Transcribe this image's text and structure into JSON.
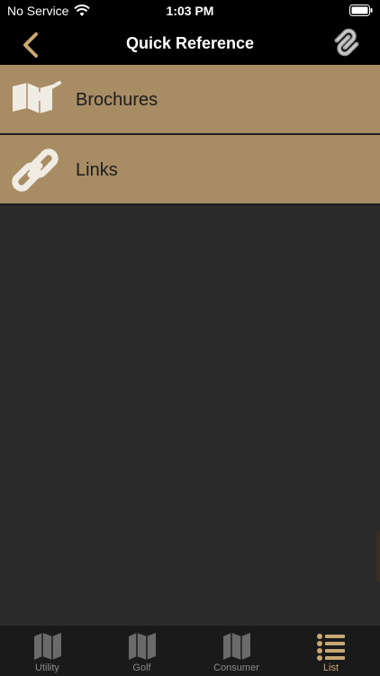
{
  "status": {
    "carrier": "No Service",
    "time": "1:03 PM"
  },
  "nav": {
    "title": "Quick Reference",
    "back_icon": "chevron-left-icon",
    "logo_icon": "chain-logo-icon"
  },
  "items": [
    {
      "label": "Brochures",
      "icon": "map-icon"
    },
    {
      "label": "Links",
      "icon": "link-icon"
    }
  ],
  "tabs": [
    {
      "label": "Utility",
      "icon": "map-icon"
    },
    {
      "label": "Golf",
      "icon": "map-icon"
    },
    {
      "label": "Consumer",
      "icon": "map-icon"
    },
    {
      "label": "List",
      "icon": "list-icon"
    }
  ],
  "colors": {
    "accent": "#c8a873",
    "row_bg": "#a88c64",
    "background": "#2a2a2a"
  }
}
